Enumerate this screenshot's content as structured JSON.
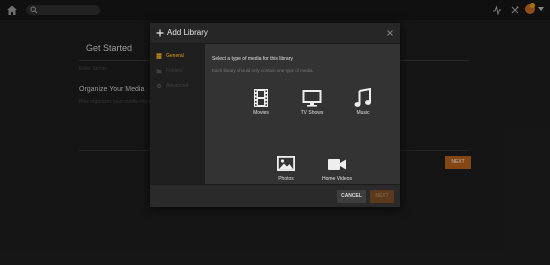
{
  "topbar": {
    "search_placeholder": ""
  },
  "background_page": {
    "title": "Get Started",
    "step": "Enter Server",
    "section_heading": "Organize Your Media",
    "section_text": "Plex organizes your media into libraries...",
    "next_label": "NEXT"
  },
  "modal": {
    "title": "Add Library",
    "sidebar": [
      {
        "label": "General",
        "active": true
      },
      {
        "label": "Folders",
        "active": false
      },
      {
        "label": "Advanced",
        "active": false
      }
    ],
    "prompt": "Select a type of media for this library",
    "note": "Each library should only contain one type of media.",
    "media_types": [
      {
        "label": "Movies",
        "icon": "film-icon"
      },
      {
        "label": "TV Shows",
        "icon": "tv-icon"
      },
      {
        "label": "Music",
        "icon": "music-note-icon"
      },
      {
        "label": "Photos",
        "icon": "photo-icon"
      },
      {
        "label": "Home Videos",
        "icon": "video-camera-icon"
      }
    ],
    "cancel_label": "CANCEL",
    "next_label": "NEXT"
  },
  "colors": {
    "accent": "#e5a00d",
    "button_orange": "#b8611a"
  }
}
